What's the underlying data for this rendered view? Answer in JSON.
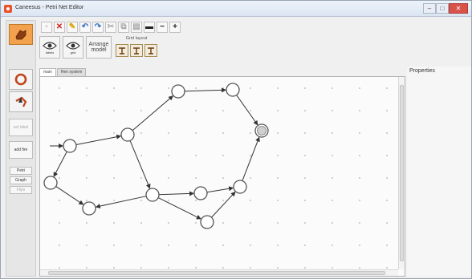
{
  "window": {
    "title": "Caneesus - Petri Net Editor",
    "controls": {
      "minimize": "–",
      "maximize": "□",
      "close": "✕"
    }
  },
  "left_panel": {
    "big_buttons": [
      {
        "name": "hand-tool",
        "icon": "hand-icon"
      },
      {
        "name": "place-tool",
        "icon": "circle-icon"
      },
      {
        "name": "arc-tool",
        "icon": "arrow-icon"
      }
    ],
    "side_buttons": [
      {
        "label": "set label",
        "disabled": true
      },
      {
        "label": "add fire",
        "disabled": false
      }
    ],
    "mode_buttons": [
      {
        "label": "Petri",
        "disabled": false
      },
      {
        "label": "Graph",
        "disabled": false
      },
      {
        "label": "Flips",
        "disabled": true
      }
    ]
  },
  "toolbar": {
    "buttons": [
      {
        "name": "new-button",
        "glyph": "▫",
        "icon": "page-icon"
      },
      {
        "name": "delete-button",
        "glyph": "✕",
        "icon": "delete-icon"
      },
      {
        "name": "pen-button",
        "glyph": "✎",
        "icon": "pencil-icon"
      },
      {
        "name": "undo-button",
        "glyph": "↶",
        "icon": "undo-icon"
      },
      {
        "name": "redo-button",
        "glyph": "↷",
        "icon": "redo-icon"
      },
      {
        "name": "cut-button",
        "glyph": "✂",
        "icon": "scissors-icon"
      },
      {
        "name": "copy-button",
        "glyph": "⧉",
        "icon": "copy-icon"
      },
      {
        "name": "paste-button",
        "glyph": "▤",
        "icon": "paste-icon"
      },
      {
        "name": "color-button",
        "glyph": "▬",
        "icon": "color-icon"
      },
      {
        "name": "zoom-out-button",
        "glyph": "−",
        "icon": "minus-icon"
      },
      {
        "name": "zoom-in-button",
        "glyph": "+",
        "icon": "plus-icon"
      }
    ]
  },
  "ribbon": {
    "view_labels": {
      "labels_btn": "labels",
      "grid_btn": "grid"
    },
    "arrange": {
      "line1": "Arrange",
      "line2": "model"
    },
    "grid_layout_label": "Grid layout"
  },
  "tabs": [
    {
      "label": "main",
      "active": true
    },
    {
      "label": "Ren system",
      "active": false
    }
  ],
  "properties": {
    "title": "Properties"
  },
  "graph": {
    "places": [
      {
        "id": "p_a"
      },
      {
        "id": "p_b"
      },
      {
        "id": "p_c"
      },
      {
        "id": "p_d"
      },
      {
        "id": "p_e"
      },
      {
        "id": "p_f"
      },
      {
        "id": "p_g"
      },
      {
        "id": "p_h"
      },
      {
        "id": "p_i"
      },
      {
        "id": "p_j"
      },
      {
        "id": "p_k"
      }
    ],
    "marked_place": "p_f",
    "arcs": [
      {
        "from": "p_a",
        "to": "p_b"
      },
      {
        "from": "p_b",
        "to": "p_c"
      },
      {
        "from": "p_b",
        "to": "p_d"
      },
      {
        "from": "p_c",
        "to": "p_e"
      },
      {
        "from": "p_e",
        "to": "p_f"
      },
      {
        "from": "p_a",
        "to": "p_g"
      },
      {
        "from": "p_g",
        "to": "p_h"
      },
      {
        "from": "p_d",
        "to": "p_h"
      },
      {
        "from": "p_d",
        "to": "p_i"
      },
      {
        "from": "p_i",
        "to": "p_j"
      },
      {
        "from": "p_j",
        "to": "p_f"
      },
      {
        "from": "p_d",
        "to": "p_k"
      },
      {
        "from": "p_k",
        "to": "p_j"
      },
      {
        "from": "input",
        "to": "p_a"
      }
    ]
  }
}
